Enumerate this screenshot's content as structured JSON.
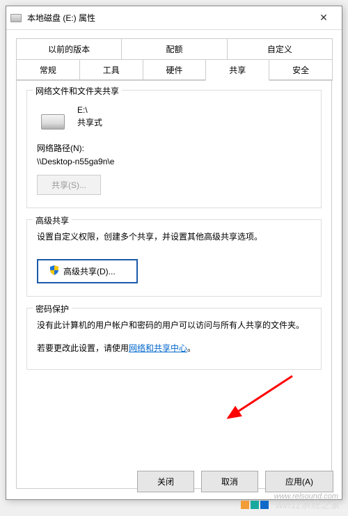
{
  "window": {
    "title": "本地磁盘 (E:) 属性"
  },
  "tabs": {
    "row1": {
      "prev_versions": "以前的版本",
      "quota": "配额",
      "customize": "自定义"
    },
    "row2": {
      "general": "常规",
      "tools": "工具",
      "hardware": "硬件",
      "sharing": "共享",
      "security": "安全"
    }
  },
  "share_group": {
    "title": "网络文件和文件夹共享",
    "drive_label": "E:\\",
    "share_mode": "共享式",
    "net_path_label": "网络路径(N):",
    "net_path_value": "\\\\Desktop-n55ga9n\\e",
    "share_btn": "共享(S)..."
  },
  "adv_group": {
    "title": "高级共享",
    "desc": "设置自定义权限，创建多个共享，并设置其他高级共享选项。",
    "btn_label": "高级共享(D)..."
  },
  "pwd_group": {
    "title": "密码保护",
    "desc1": "没有此计算机的用户帐户和密码的用户可以访问与所有人共享的文件夹。",
    "desc2_prefix": "若要更改此设置，请使用",
    "link_text": "网络和共享中心",
    "desc2_suffix": "。"
  },
  "buttons": {
    "close": "关闭",
    "cancel": "取消",
    "apply": "应用(A)"
  },
  "watermark": {
    "site": "win11系统之家",
    "url": "www.relsound.com"
  }
}
